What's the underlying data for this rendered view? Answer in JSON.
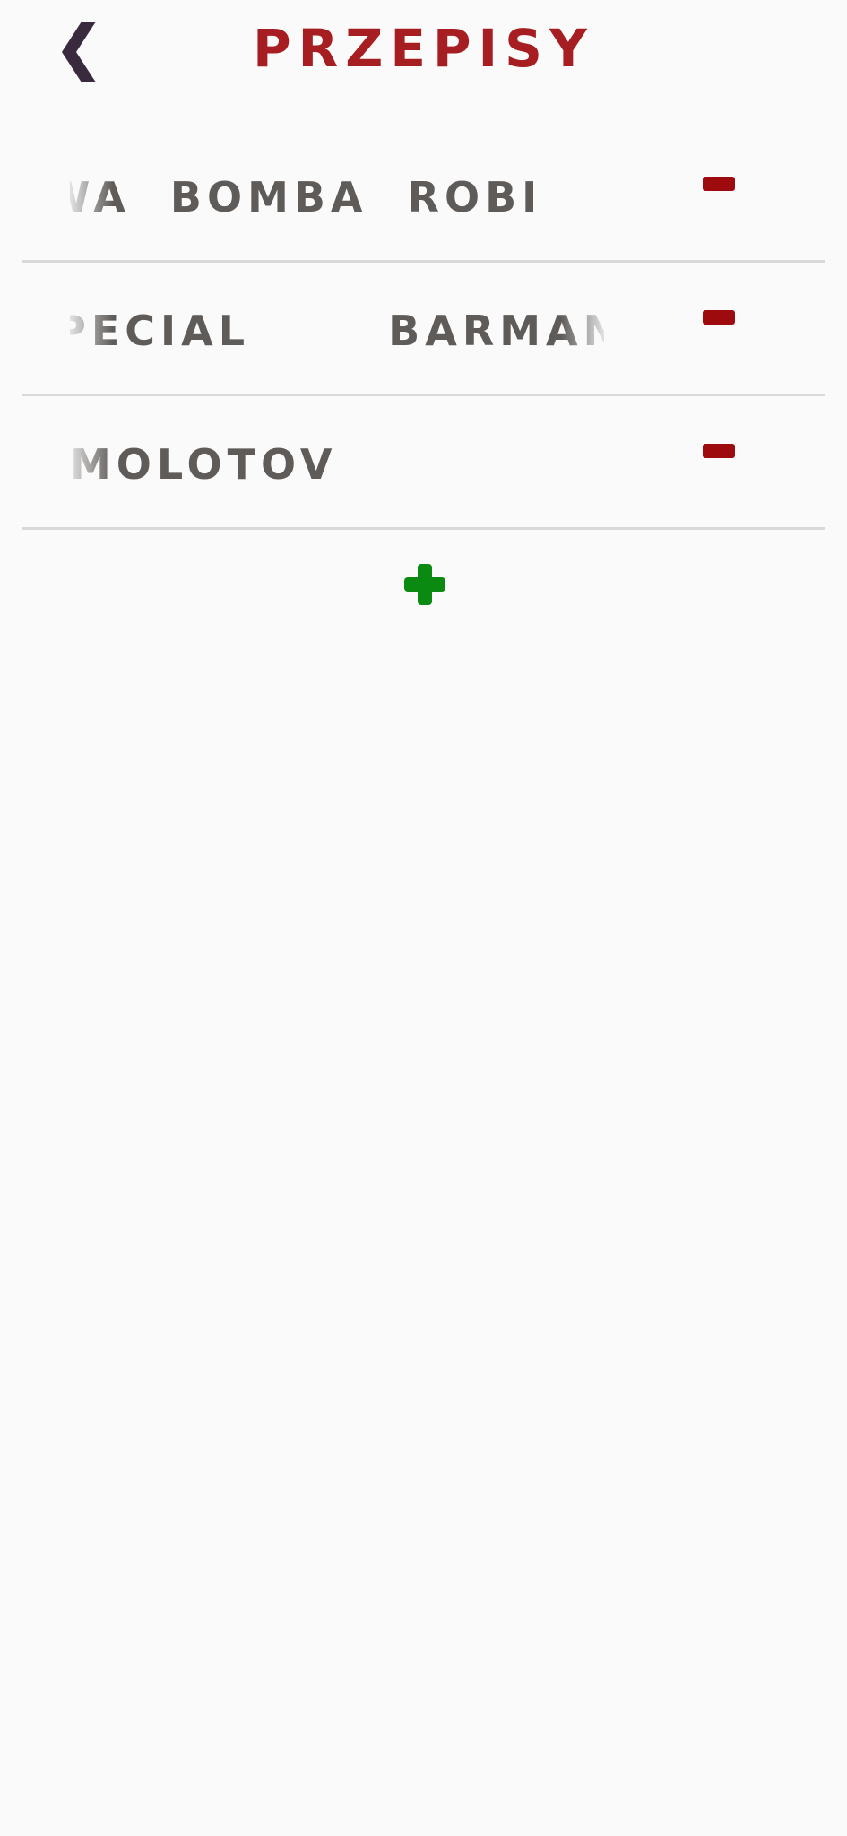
{
  "header": {
    "title": "PRZEPISY",
    "back_icon": "chevron-left-icon",
    "back_icon_glyph": "❮"
  },
  "recipes": [
    {
      "name": "NOWA  BOMBA  ROBI",
      "remove_icon": "minus-icon"
    },
    {
      "name": "SPECIAL       BARMAN",
      "remove_icon": "minus-icon"
    },
    {
      "name": "MOLOTOV",
      "remove_icon": "minus-icon"
    }
  ],
  "add_button": {
    "icon": "plus-icon"
  },
  "colors": {
    "title": "#a61e22",
    "back_icon": "#3a2a3e",
    "recipe_text": "#5f5b59",
    "remove": "#9e0b0f",
    "add": "#0b8a12",
    "divider": "#d9d9d9",
    "background": "#fafafa"
  }
}
